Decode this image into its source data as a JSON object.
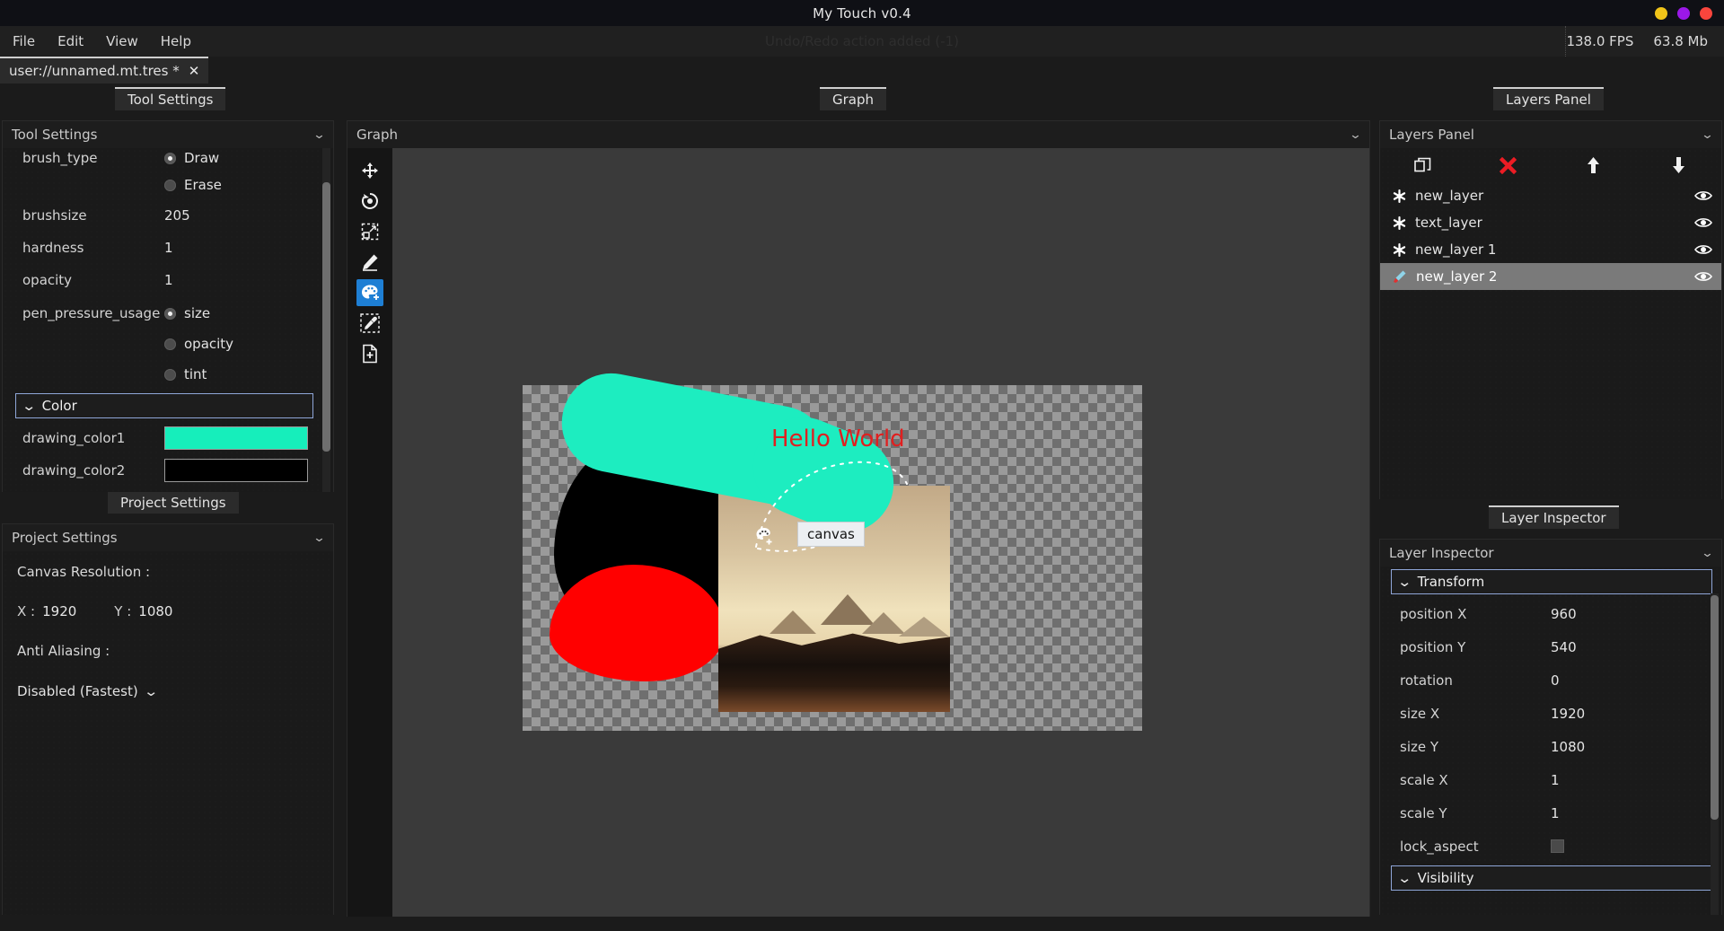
{
  "window": {
    "title": "My Touch v0.4",
    "controls": [
      {
        "name": "minimize",
        "color": "#f0c419"
      },
      {
        "name": "maximize",
        "color": "#9b18e8"
      },
      {
        "name": "close",
        "color": "#f9453d"
      }
    ]
  },
  "menubar": {
    "items": [
      "File",
      "Edit",
      "View",
      "Help"
    ],
    "status_message": "Undo/Redo action added (-1)",
    "fps": "138.0 FPS",
    "memory": "63.8 Mb"
  },
  "filetab": {
    "label": "user://unnamed.mt.tres *",
    "close_glyph": "✕"
  },
  "docktabs": {
    "tool_settings": "Tool Settings",
    "graph": "Graph",
    "layers_panel": "Layers Panel",
    "project_settings": "Project Settings",
    "layer_inspector": "Layer Inspector"
  },
  "tool_settings": {
    "title": "Tool Settings",
    "rows": [
      {
        "label": "brush_type",
        "type": "radio",
        "value": "Draw",
        "selected": true
      },
      {
        "label": "",
        "type": "radio",
        "value": "Erase",
        "selected": false
      },
      {
        "label": "brushsize",
        "type": "value",
        "value": "205"
      },
      {
        "label": "hardness",
        "type": "value",
        "value": "1"
      },
      {
        "label": "opacity",
        "type": "value",
        "value": "1"
      },
      {
        "label": "pen_pressure_usage",
        "type": "radio",
        "value": "size",
        "selected": true
      },
      {
        "label": "",
        "type": "radio",
        "value": "opacity",
        "selected": false
      },
      {
        "label": "",
        "type": "radio",
        "value": "tint",
        "selected": false
      }
    ],
    "color_section": "Color",
    "colors": [
      {
        "label": "drawing_color1",
        "value": "#16eebb"
      },
      {
        "label": "drawing_color2",
        "value": "#000000"
      }
    ]
  },
  "project_settings": {
    "title": "Project Settings",
    "canvas_resolution_label": "Canvas Resolution :",
    "x_key": "X :",
    "x_value": "1920",
    "y_key": "Y :",
    "y_value": "1080",
    "anti_aliasing_label": "Anti Aliasing :",
    "anti_aliasing_value": "Disabled (Fastest)"
  },
  "graph": {
    "title": "Graph",
    "tools": [
      {
        "name": "move-tool",
        "active": false
      },
      {
        "name": "rotate-tool",
        "active": false
      },
      {
        "name": "scale-tool",
        "active": false
      },
      {
        "name": "pencil-tool",
        "active": false
      },
      {
        "name": "palette-tool",
        "active": true
      },
      {
        "name": "eyedropper-tool",
        "active": false
      },
      {
        "name": "add-layer-tool",
        "active": false
      }
    ],
    "canvas_label": "canvas",
    "artwork_text": "Hello World",
    "artwork_text_color": "#e02020"
  },
  "layers_panel": {
    "title": "Layers Panel",
    "toolbar": [
      {
        "name": "duplicate-layer-button",
        "glyph": "duplicate"
      },
      {
        "name": "delete-layer-button",
        "glyph": "delete"
      },
      {
        "name": "move-layer-up-button",
        "glyph": "up"
      },
      {
        "name": "move-layer-down-button",
        "glyph": "down"
      }
    ],
    "layers": [
      {
        "name": "new_layer",
        "icon": "gear-icon",
        "selected": false,
        "visible": true
      },
      {
        "name": "text_layer",
        "icon": "gear-icon",
        "selected": false,
        "visible": true
      },
      {
        "name": "new_layer 1",
        "icon": "gear-icon",
        "selected": false,
        "visible": true
      },
      {
        "name": "new_layer 2",
        "icon": "brush-icon",
        "selected": true,
        "visible": true
      }
    ]
  },
  "layer_inspector": {
    "title": "Layer Inspector",
    "transform_section": "Transform",
    "properties": [
      {
        "label": "position X",
        "value": "960",
        "type": "value"
      },
      {
        "label": "position Y",
        "value": "540",
        "type": "value"
      },
      {
        "label": "rotation",
        "value": "0",
        "type": "value"
      },
      {
        "label": "size X",
        "value": "1920",
        "type": "value"
      },
      {
        "label": "size Y",
        "value": "1080",
        "type": "value"
      },
      {
        "label": "scale X",
        "value": "1",
        "type": "value"
      },
      {
        "label": "scale Y",
        "value": "1",
        "type": "value"
      },
      {
        "label": "lock_aspect",
        "value": "",
        "type": "checkbox"
      }
    ],
    "visibility_section": "Visibility"
  }
}
